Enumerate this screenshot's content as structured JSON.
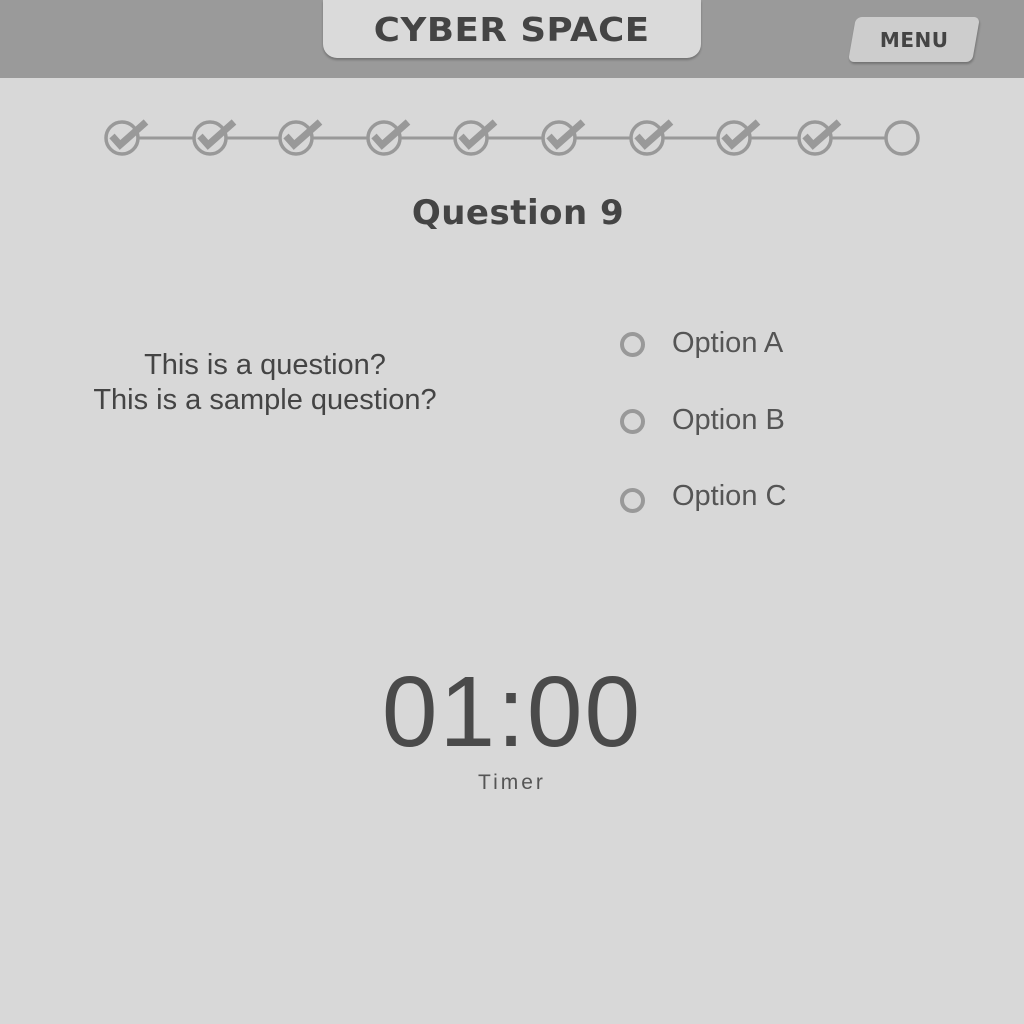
{
  "header": {
    "title": "CYBER SPACE",
    "menu_label": "MENU"
  },
  "progress": {
    "total_steps": 10,
    "completed_steps": 9
  },
  "question": {
    "heading": "Question 9",
    "lines": [
      "This is a question?",
      "This is a sample question?"
    ]
  },
  "options": [
    {
      "label": "Option A",
      "selected": false
    },
    {
      "label": "Option B",
      "selected": false
    },
    {
      "label": "Option C",
      "selected": false
    }
  ],
  "timer": {
    "value": "01:00",
    "label": "Timer"
  },
  "colors": {
    "background": "#d8d8d8",
    "topbar": "#9a9a9a",
    "text": "#444444",
    "accent_gray": "#999999"
  }
}
